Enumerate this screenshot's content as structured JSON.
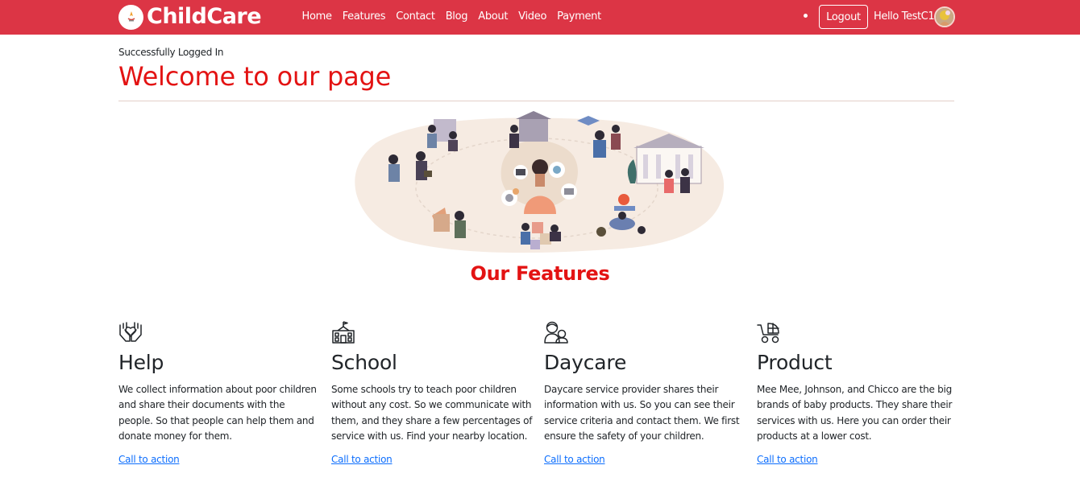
{
  "brand": {
    "name": "ChildCare",
    "logo_icon": "childcare-logo-icon"
  },
  "nav": {
    "links": [
      {
        "label": "Home"
      },
      {
        "label": "Features"
      },
      {
        "label": "Contact"
      },
      {
        "label": "Blog"
      },
      {
        "label": "About"
      },
      {
        "label": "Video"
      },
      {
        "label": "Payment"
      }
    ],
    "logout_label": "Logout",
    "greeting": "Hello TestC1"
  },
  "status_message": "Successfully Logged In",
  "page_title": "Welcome to our page",
  "features_heading": "Our Features",
  "features": [
    {
      "icon": "helping-hands-icon",
      "title": "Help",
      "text": "We collect information about poor children and share their documents with the people. So that people can help them and donate money for them.",
      "link": "Call to action"
    },
    {
      "icon": "school-building-icon",
      "title": "School",
      "text": "Some schools try to teach poor children without any cost. So we communicate with them, and they share a few percentages of service with us. Find your nearby location.",
      "link": "Call to action"
    },
    {
      "icon": "parent-child-icon",
      "title": "Daycare",
      "text": "Daycare service provider shares their information with us. So you can see their service criteria and contact them. We first ensure the safety of your children.",
      "link": "Call to action"
    },
    {
      "icon": "baby-stroller-icon",
      "title": "Product",
      "text": "Mee Mee, Johnson, and Chicco are the big brands of baby products. They share their services with us. Here you can order their products at a lower cost.",
      "link": "Call to action"
    }
  ],
  "colors": {
    "navbar": "#dc3545",
    "heading": "#e31313",
    "link": "#0d6efd"
  }
}
